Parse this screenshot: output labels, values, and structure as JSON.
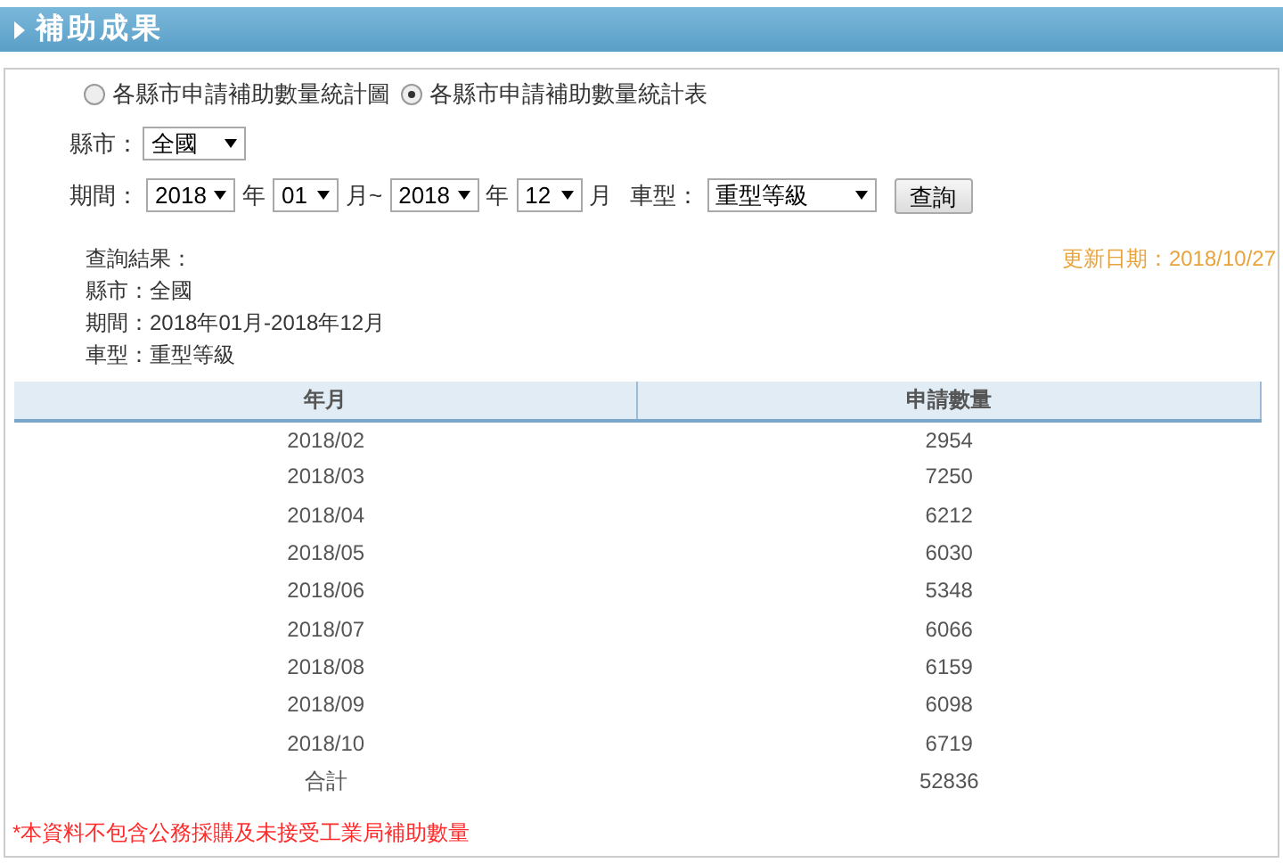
{
  "header": {
    "title": "補助成果"
  },
  "view_options": [
    {
      "label": "各縣市申請補助數量統計圖",
      "selected": false
    },
    {
      "label": "各縣市申請補助數量統計表",
      "selected": true
    }
  ],
  "city": {
    "label": "縣市：",
    "value": "全國"
  },
  "period": {
    "label": "期間：",
    "start_year": "2018",
    "year_unit_1": "年",
    "start_month": "01",
    "month_unit_1": "月~",
    "end_year": "2018",
    "year_unit_2": "年",
    "end_month": "12",
    "month_unit_2": "月"
  },
  "vehicle": {
    "label": "車型：",
    "value": "重型等級"
  },
  "query_button": "查詢",
  "result": {
    "title": "查詢結果：",
    "city": "縣市：全國",
    "period": "期間：2018年01月-2018年12月",
    "vehicle": "車型：重型等級",
    "updated": "更新日期：2018/10/27"
  },
  "table": {
    "columns": [
      "年月",
      "申請數量"
    ],
    "rows": [
      [
        "2018/02",
        "2954"
      ],
      [
        "2018/03",
        "7250"
      ],
      [
        "2018/04",
        "6212"
      ],
      [
        "2018/05",
        "6030"
      ],
      [
        "2018/06",
        "5348"
      ],
      [
        "2018/07",
        "6066"
      ],
      [
        "2018/08",
        "6159"
      ],
      [
        "2018/09",
        "6098"
      ],
      [
        "2018/10",
        "6719"
      ],
      [
        "合計",
        "52836"
      ]
    ]
  },
  "footnote": "*本資料不包含公務採購及未接受工業局補助數量"
}
